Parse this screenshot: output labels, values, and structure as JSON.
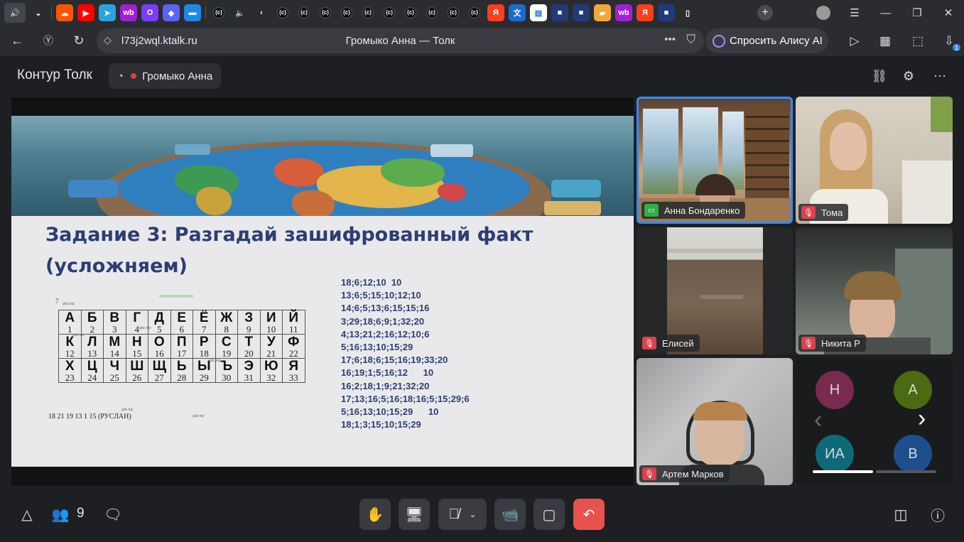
{
  "browser": {
    "url": "l73j2wql.ktalk.ru",
    "page_title": "Громыко Анна — Толк",
    "alice_label": "Спросить Алису AI",
    "tab_icons": [
      "audio-playing-icon",
      "chevron-down-icon",
      "soundcloud-icon",
      "youtube-icon",
      "telegram-icon",
      "wildberries-icon",
      "ozon-icon",
      "app-icon",
      "chat-icon",
      "c-site-icon",
      "audio-icon",
      "back-chevron-icon",
      "c-site-icon",
      "c-site-icon",
      "c-site-icon",
      "c-site-icon",
      "c-site-icon",
      "c-site-icon",
      "c-site-icon",
      "c-site-icon",
      "c-site-icon",
      "c-site-icon",
      "yandex-icon",
      "translate-icon",
      "google-docs-icon",
      "tab-icon",
      "tab-icon",
      "folder-icon",
      "wildberries-icon",
      "yandex-icon",
      "tab-icon",
      "document-icon"
    ],
    "c_label": "(c)",
    "wb_label": "wb",
    "ya_label": "Я",
    "new_tab": "+",
    "downloads_badge": "1"
  },
  "app": {
    "brand": "Контур Толк",
    "presenter": "Громыко Анна",
    "participants_count": "9"
  },
  "slide": {
    "title": "Задание 3: Разгадай зашифрованный факт (усложняем)",
    "number_mark": "7",
    "alphabet_rows": [
      [
        {
          "l": "А",
          "n": "1"
        },
        {
          "l": "Б",
          "n": "2"
        },
        {
          "l": "В",
          "n": "3"
        },
        {
          "l": "Г",
          "n": "4"
        },
        {
          "l": "Д",
          "n": "5"
        },
        {
          "l": "Е",
          "n": "6"
        },
        {
          "l": "Ё",
          "n": "7"
        },
        {
          "l": "Ж",
          "n": "8"
        },
        {
          "l": "З",
          "n": "9"
        },
        {
          "l": "И",
          "n": "10"
        },
        {
          "l": "Й",
          "n": "11"
        }
      ],
      [
        {
          "l": "К",
          "n": "12"
        },
        {
          "l": "Л",
          "n": "13"
        },
        {
          "l": "М",
          "n": "14"
        },
        {
          "l": "Н",
          "n": "15"
        },
        {
          "l": "О",
          "n": "16"
        },
        {
          "l": "П",
          "n": "17"
        },
        {
          "l": "Р",
          "n": "18"
        },
        {
          "l": "С",
          "n": "19"
        },
        {
          "l": "Т",
          "n": "20"
        },
        {
          "l": "У",
          "n": "21"
        },
        {
          "l": "Ф",
          "n": "22"
        }
      ],
      [
        {
          "l": "Х",
          "n": "23"
        },
        {
          "l": "Ц",
          "n": "24"
        },
        {
          "l": "Ч",
          "n": "25"
        },
        {
          "l": "Ш",
          "n": "26"
        },
        {
          "l": "Щ",
          "n": "27"
        },
        {
          "l": "Ь",
          "n": "28"
        },
        {
          "l": "Ы",
          "n": "29"
        },
        {
          "l": "Ъ",
          "n": "30"
        },
        {
          "l": "Э",
          "n": "31"
        },
        {
          "l": "Ю",
          "n": "32"
        },
        {
          "l": "Я",
          "n": "33"
        }
      ]
    ],
    "example": "18 21 19 13 1 15 (РУСЛАН)",
    "watermark": "gdz.top",
    "codes": [
      "18;6;12;10  10",
      "13;6;5;15;10;12;10",
      "14;6;5;13;6;15;15;16",
      "3;29;18;6;9;1;32;20",
      "4;13;21;2;16;12;10;6",
      "5;16;13;10;15;29",
      "17;6;18;6;15;16;19;33;20",
      "16;19;1;5;16;12      10",
      "16;2;18;1;9;21;32;20",
      "17;13;16;5;16;18;16;5;15;29;6",
      "5;16;13;10;15;29      10",
      "18;1;3;15;10;15;29"
    ]
  },
  "participants": [
    {
      "name": "Анна Бондаренко",
      "status": "screen-sharing",
      "speaking": true
    },
    {
      "name": "Тома",
      "status": "muted"
    },
    {
      "name": "Елисей",
      "status": "muted"
    },
    {
      "name": "Никита Р",
      "status": "muted"
    },
    {
      "name": "Артем Марков",
      "status": "muted"
    }
  ],
  "more_avatars": [
    {
      "initials": "Н",
      "color": "#7a2a4e"
    },
    {
      "initials": "А",
      "color": "#4c6a12"
    },
    {
      "initials": "ИА",
      "color": "#0e6a78"
    },
    {
      "initials": "В",
      "color": "#1d4f8c"
    }
  ],
  "colors": {
    "accent_blue": "#2f8cff",
    "mute_red": "#d9434b",
    "leave_red": "#e8524e",
    "screen_green": "#2fae4a",
    "slide_title": "#2c3e73"
  }
}
